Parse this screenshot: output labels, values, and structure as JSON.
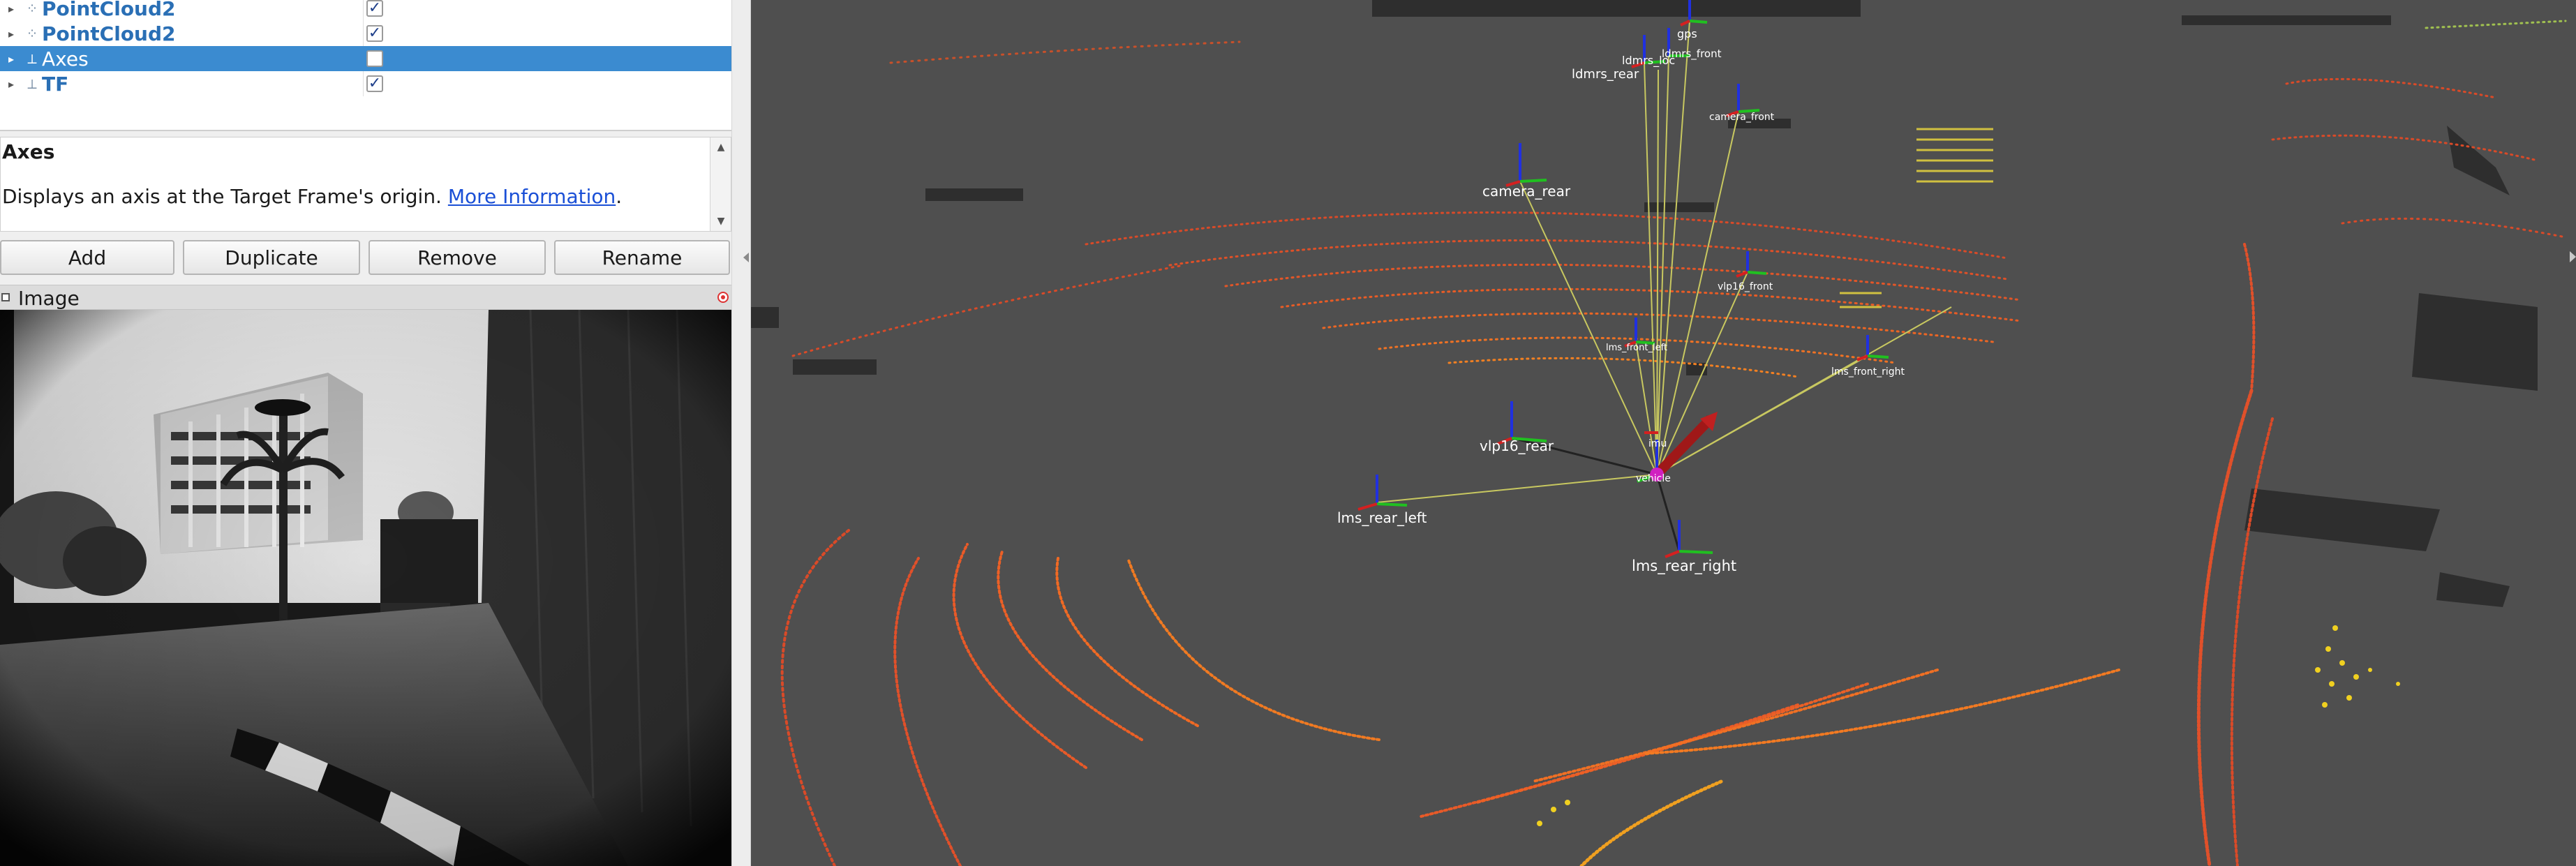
{
  "displays_tree": {
    "items": [
      {
        "label": "PointCloud2",
        "icon": "point-cloud-icon",
        "checked": true,
        "selected": false
      },
      {
        "label": "PointCloud2",
        "icon": "point-cloud-icon",
        "checked": true,
        "selected": false
      },
      {
        "label": "Axes",
        "icon": "axes-icon",
        "checked": false,
        "selected": true
      },
      {
        "label": "TF",
        "icon": "tf-icon",
        "checked": true,
        "selected": false
      }
    ],
    "checkmark": "✓"
  },
  "description": {
    "title": "Axes",
    "text": "Displays an axis at the Target Frame's origin. ",
    "link": "More Information",
    "suffix": "."
  },
  "buttons": {
    "add": "Add",
    "duplicate": "Duplicate",
    "remove": "Remove",
    "rename": "Rename"
  },
  "image_panel": {
    "title": "Image"
  },
  "scene": {
    "frames": [
      "gps",
      "ldmrs_loc",
      "ldmrs_front",
      "ldmrs_rear",
      "camera_front",
      "camera_rear",
      "vlp16_front",
      "lms_front_left",
      "lms_front_right",
      "vlp16_rear",
      "imu",
      "vehicle",
      "lms_rear_left",
      "lms_rear_right"
    ]
  },
  "colors": {
    "selection": "#3b8bd0",
    "tree_label": "#2a6fb5",
    "grid_background": "#4f4f4f",
    "axis_x": "#d42020",
    "axis_y": "#20c020",
    "axis_z": "#2030e0",
    "tf_link": "#c8c860",
    "pointcloud_near": "#e0502a",
    "pointcloud_far": "#f0a020"
  }
}
